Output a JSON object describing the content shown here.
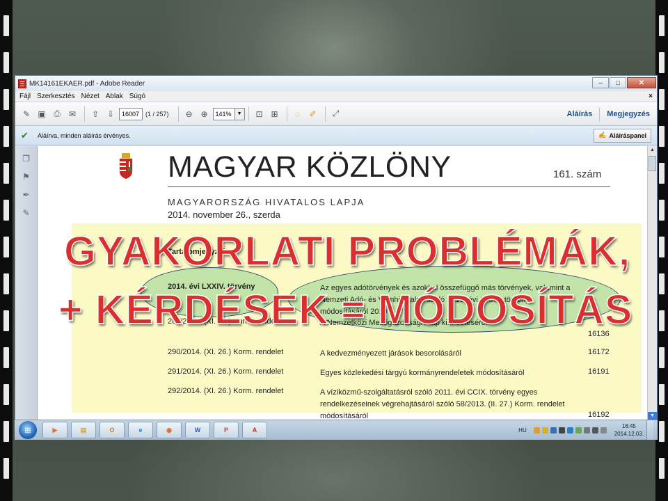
{
  "window": {
    "title": "MK14161EKAER.pdf - Adobe Reader",
    "controls": [
      "–",
      "□",
      "✕"
    ]
  },
  "menu": {
    "items": [
      "Fájl",
      "Szerkesztés",
      "Nézet",
      "Ablak",
      "Súgó"
    ],
    "close": "×"
  },
  "toolbar": {
    "page_number": "16007",
    "page_count": "(1 / 257)",
    "zoom": "141%",
    "sign_label": "Aláírás",
    "comment_label": "Megjegyzés"
  },
  "signature_bar": {
    "message": "Aláírva, minden aláírás érvényes.",
    "panel_button": "Aláíráspanel"
  },
  "document": {
    "title": "MAGYAR KÖZLÖNY",
    "issue": "161. szám",
    "subtitle": "MAGYARORSZÁG HIVATALOS LAPJA",
    "date": "2014.  november 26., szerda",
    "toc_heading": "Tartalomjegyzék",
    "rows": [
      {
        "act": "2014. évi LXXIV. törvény",
        "desc": "Az egyes adótörvények és azokkal összefüggő más törvények, valamint a Nemzeti Adó- és Vámhivatalról szóló 2010. évi CXXII. törvény módosításáról 2010",
        "page": "",
        "bold": true
      },
      {
        "act": "289/2014. (XI. 26.) Korm. rendelet",
        "desc": "A Nemzetközi Mezőgazdasági Alap kihirdetéséről",
        "page": "16136",
        "bold": false
      },
      {
        "act": "290/2014. (XI. 26.) Korm. rendelet",
        "desc": "A kedvezményezett járások besorolásáról",
        "page": "16172",
        "bold": false
      },
      {
        "act": "291/2014. (XI. 26.) Korm. rendelet",
        "desc": "Egyes közlekedési tárgyú kormányrendeletek módosításáról",
        "page": "16191",
        "bold": false
      },
      {
        "act": "292/2014. (XI. 26.) Korm. rendelet",
        "desc": "A víziközmű-szolgáltatásról szóló 2011. évi CCIX. törvény egyes rendelkezéseinek végrehajtásáról szóló 58/2013. (II. 27.) Korm. rendelet módosításáról",
        "page": "16192",
        "bold": false
      }
    ]
  },
  "overlay": {
    "line1": "GYAKORLATI PROBLÉMÁK,",
    "line2": "+ KÉRDÉSEK = MÓDOSÍTÁS"
  },
  "taskbar": {
    "start_icon": "windows-orb",
    "apps": [
      {
        "name": "media-player",
        "label": "▶",
        "color": "#e0752a"
      },
      {
        "name": "explorer",
        "label": "▤",
        "color": "#d9a838"
      },
      {
        "name": "outlook",
        "label": "O",
        "color": "#d9762a"
      },
      {
        "name": "internet-explorer",
        "label": "e",
        "color": "#2f7ed8"
      },
      {
        "name": "firefox",
        "label": "◉",
        "color": "#e06a1e"
      },
      {
        "name": "word",
        "label": "W",
        "color": "#2a5aa8"
      },
      {
        "name": "powerpoint",
        "label": "P",
        "color": "#c8482a"
      },
      {
        "name": "adobe-reader",
        "label": "A",
        "color": "#c8261f"
      }
    ],
    "language": "HU",
    "time": "18:45",
    "date": "2014.12.03."
  }
}
